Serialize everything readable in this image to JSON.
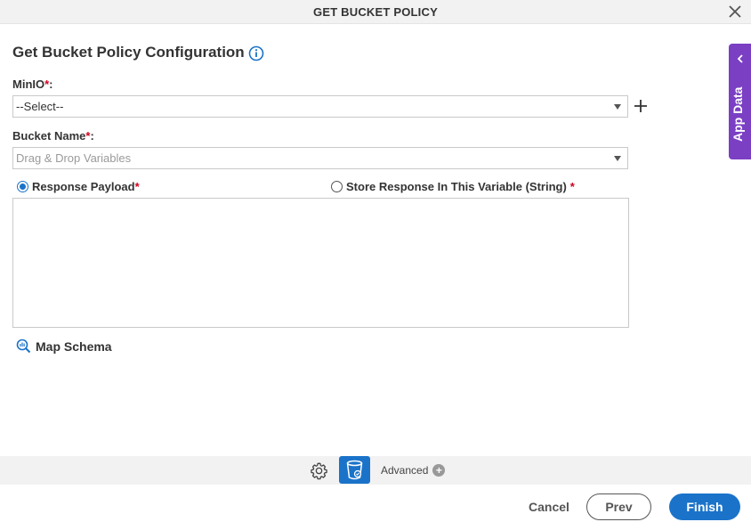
{
  "dialog": {
    "title": "GET BUCKET POLICY"
  },
  "form": {
    "heading": "Get Bucket Policy Configuration",
    "minio": {
      "label": "MinIO",
      "required_mark": "*",
      "colon": ":",
      "value": "--Select--"
    },
    "bucket_name": {
      "label": "Bucket Name",
      "required_mark": "*",
      "colon": ":",
      "placeholder": "Drag & Drop Variables"
    },
    "response_payload": {
      "label": "Response Payload",
      "required_mark": "*",
      "selected": true
    },
    "store_response": {
      "label": "Store Response In This Variable (String)",
      "required_mark": "*",
      "selected": false
    },
    "map_schema": {
      "label": "Map Schema"
    }
  },
  "side_panel": {
    "label": "App Data"
  },
  "toolbar": {
    "advanced_label": "Advanced"
  },
  "footer": {
    "cancel_label": "Cancel",
    "prev_label": "Prev",
    "finish_label": "Finish"
  },
  "colors": {
    "accent": "#1a73c9",
    "app_data_tab": "#7b3fc4",
    "required": "#d0021b"
  }
}
